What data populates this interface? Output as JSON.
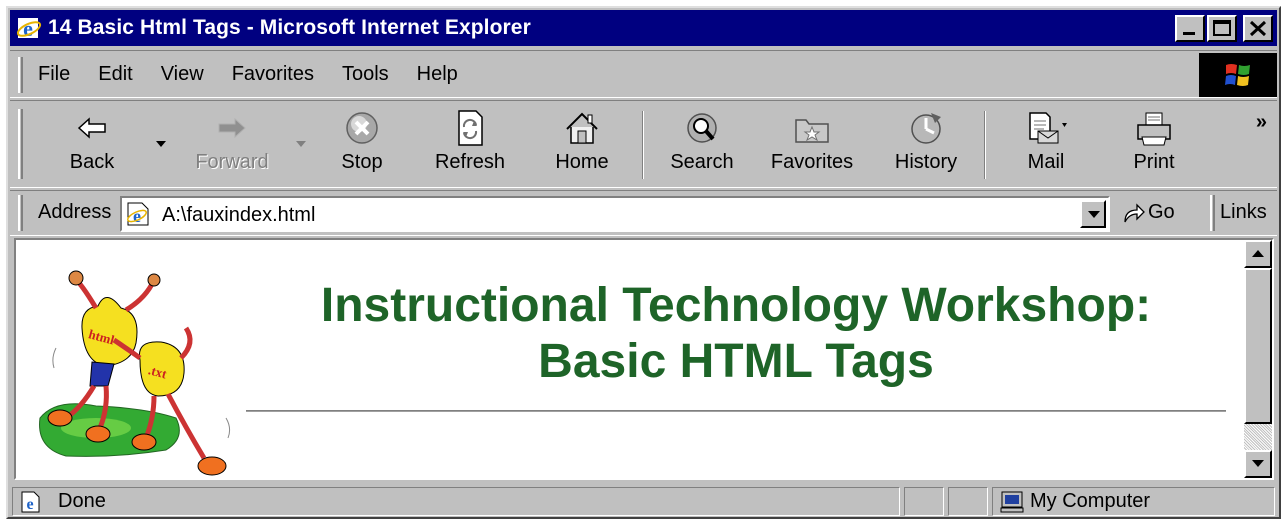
{
  "window": {
    "title": "14 Basic Html Tags - Microsoft Internet Explorer"
  },
  "menu": {
    "items": [
      {
        "label": "File"
      },
      {
        "label": "Edit"
      },
      {
        "label": "View"
      },
      {
        "label": "Favorites"
      },
      {
        "label": "Tools"
      },
      {
        "label": "Help"
      }
    ]
  },
  "toolbar": {
    "back": {
      "label": "Back",
      "icon": "back-arrow-icon"
    },
    "forward": {
      "label": "Forward",
      "icon": "forward-arrow-icon",
      "disabled": true
    },
    "stop": {
      "label": "Stop",
      "icon": "stop-icon"
    },
    "refresh": {
      "label": "Refresh",
      "icon": "refresh-icon"
    },
    "home": {
      "label": "Home",
      "icon": "home-icon"
    },
    "search": {
      "label": "Search",
      "icon": "search-icon"
    },
    "favorites": {
      "label": "Favorites",
      "icon": "favorites-folder-icon"
    },
    "history": {
      "label": "History",
      "icon": "history-icon"
    },
    "mail": {
      "label": "Mail",
      "icon": "mail-icon"
    },
    "print": {
      "label": "Print",
      "icon": "print-icon"
    },
    "more": "»"
  },
  "address": {
    "label": "Address",
    "value": "A:\\fauxindex.html",
    "go_label": "Go",
    "links_label": "Links"
  },
  "page": {
    "heading_line1": "Instructional Technology Workshop:",
    "heading_line2": "Basic HTML Tags",
    "heading_color": "#1e6428",
    "mascot_labels": [
      "html",
      ".txt"
    ]
  },
  "status": {
    "text": "Done",
    "zone": "My Computer"
  },
  "colors": {
    "titlebar": "#000080",
    "chrome": "#c0c0c0"
  }
}
